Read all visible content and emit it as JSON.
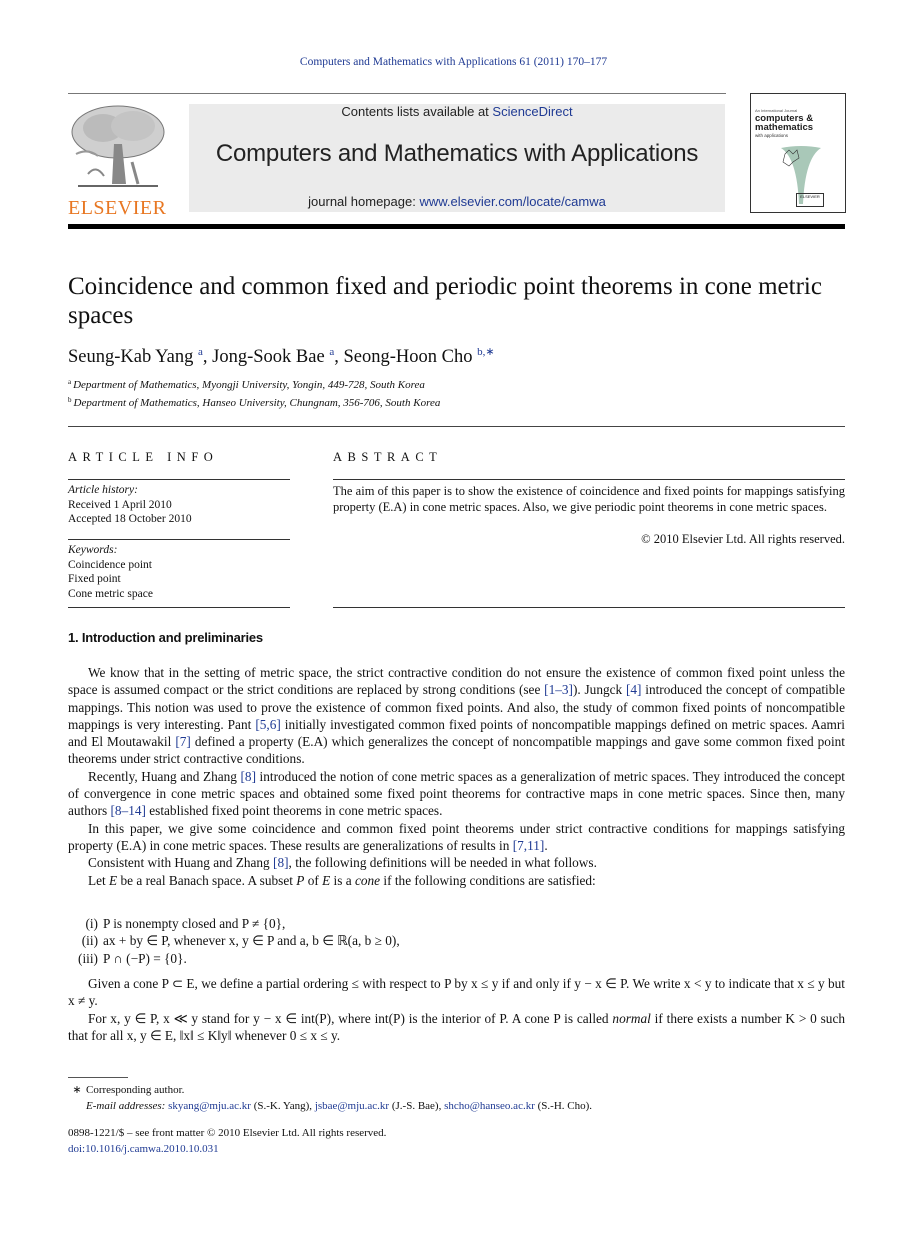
{
  "running_head": "Computers and Mathematics with Applications 61 (2011) 170–177",
  "header": {
    "publisher_logo_text": "ELSEVIER",
    "contents_prefix": "Contents lists available at ",
    "contents_link": "ScienceDirect",
    "journal_title": "Computers and Mathematics with Applications",
    "homepage_prefix": "journal homepage: ",
    "homepage_link": "www.elsevier.com/locate/camwa",
    "cover": {
      "line1": "An International Journal",
      "line2a": "computers &",
      "line2b": "mathematics",
      "line3": "with applications",
      "badge": "ELSEVIER"
    }
  },
  "article": {
    "title": "Coincidence and common fixed and periodic point theorems in cone metric spaces",
    "authors": [
      {
        "name": "Seung-Kab Yang",
        "sup": "a"
      },
      {
        "name": "Jong-Sook Bae",
        "sup": "a"
      },
      {
        "name": "Seong-Hoon Cho",
        "sup": "b,∗"
      }
    ],
    "affiliations": [
      {
        "mark": "a",
        "text": "Department of Mathematics, Myongji University, Yongin, 449-728, South Korea"
      },
      {
        "mark": "b",
        "text": "Department of Mathematics, Hanseo University, Chungnam, 356-706, South Korea"
      }
    ]
  },
  "article_info": {
    "heading": "ARTICLE INFO",
    "history_label": "Article history:",
    "received": "Received 1 April 2010",
    "accepted": "Accepted 18 October 2010",
    "keywords_label": "Keywords:",
    "keywords": [
      "Coincidence point",
      "Fixed point",
      "Cone metric space"
    ]
  },
  "abstract": {
    "heading": "ABSTRACT",
    "text": "The aim of this paper is to show the existence of coincidence and fixed points for mappings satisfying property (E.A) in cone metric spaces. Also, we give periodic point theorems in cone metric spaces.",
    "copyright": "© 2010 Elsevier Ltd. All rights reserved."
  },
  "section1": {
    "heading": "1.  Introduction and preliminaries",
    "p1": {
      "a": "We know that in the setting of metric space, the strict contractive condition do not ensure the existence of common fixed point unless the space is assumed compact or the strict conditions are replaced by strong conditions (see ",
      "ref1": "[1–3]",
      "b": "). Jungck ",
      "ref2": "[4]",
      "c": " introduced the concept of compatible mappings. This notion was used to prove the existence of common fixed points. And also, the study of common fixed points of noncompatible mappings is very interesting. Pant ",
      "ref3": "[5,6]",
      "d": " initially investigated common fixed points of noncompatible mappings defined on metric spaces. Aamri and El Moutawakil ",
      "ref4": "[7]",
      "e": " defined a property (E.A) which generalizes the concept of noncompatible mappings and gave some common fixed point theorems under strict contractive conditions."
    },
    "p2": {
      "a": "Recently, Huang and Zhang ",
      "ref1": "[8]",
      "b": " introduced the notion of cone metric spaces as a generalization of metric spaces. They introduced the concept of convergence in cone metric spaces and obtained some fixed point theorems for contractive maps in cone metric spaces. Since then, many authors ",
      "ref2": "[8–14]",
      "c": " established fixed point theorems in cone metric spaces."
    },
    "p3": {
      "a": "In this paper, we give some coincidence and common fixed point theorems under strict contractive conditions for mappings satisfying property (E.A) in cone metric spaces. These results are generalizations of results in ",
      "ref1": "[7,11]",
      "b": "."
    },
    "p4": {
      "a": "Consistent with Huang and Zhang ",
      "ref1": "[8]",
      "b": ", the following definitions will be needed in what follows."
    },
    "p5": {
      "a": "Let ",
      "E": "E",
      "b": " be a real Banach space. A subset ",
      "P": "P",
      "c": " of ",
      "E2": "E",
      "d": " is a ",
      "cone": "cone",
      "e": " if the following conditions are satisfied:"
    },
    "conditions": [
      {
        "num": "(i)",
        "text": "P is nonempty closed and P ≠ {0},"
      },
      {
        "num": "(ii)",
        "text": "ax + by ∈ P, whenever x, y ∈ P and a, b ∈ ℝ(a, b ≥ 0),"
      },
      {
        "num": "(iii)",
        "text": "P ∩ (−P) = {0}."
      }
    ],
    "p6": "Given a cone P ⊂ E, we define a partial ordering ≤ with respect to P by x ≤ y if and only if y − x ∈ P. We write x < y to indicate that x ≤ y but x ≠ y.",
    "p7": {
      "a": "For x, y ∈ P, x ≪ y stand for y − x ∈ int(P), where int(P) is the interior of P. A cone P is called ",
      "normal": "normal",
      "b": " if there exists a number K > 0 such that for all x, y ∈ E, ‖x‖ ≤ K‖y‖ whenever 0 ≤ x ≤ y."
    }
  },
  "footnote": {
    "mark": "∗",
    "corresponding": "Corresponding author.",
    "email_label": "E-mail addresses:",
    "emails": [
      {
        "addr": "skyang@mju.ac.kr",
        "who": " (S.-K. Yang), "
      },
      {
        "addr": "jsbae@mju.ac.kr",
        "who": " (J.-S. Bae), "
      },
      {
        "addr": "shcho@hanseo.ac.kr",
        "who": " (S.-H. Cho)."
      }
    ]
  },
  "bottom": {
    "issn": "0898-1221/$ – see front matter © 2010 Elsevier Ltd. All rights reserved.",
    "doi": "doi:10.1016/j.camwa.2010.10.031"
  }
}
